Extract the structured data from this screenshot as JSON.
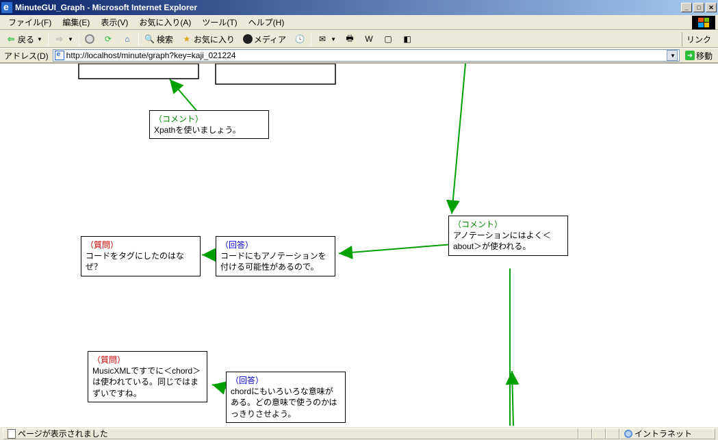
{
  "window": {
    "title": "MinuteGUI_Graph - Microsoft Internet Explorer"
  },
  "menu": {
    "file": "ファイル(F)",
    "edit": "編集(E)",
    "view": "表示(V)",
    "favorites": "お気に入り(A)",
    "tools": "ツール(T)",
    "help": "ヘルプ(H)"
  },
  "toolbar": {
    "back": "戻る",
    "search": "検索",
    "favorites": "お気に入り",
    "media": "メディア",
    "links": "リンク"
  },
  "address": {
    "label": "アドレス(D)",
    "url": "http://localhost/minute/graph?key=kaji_021224",
    "go": "移動"
  },
  "nodes": {
    "n1": {
      "tagType": "comment",
      "tag": "（コメント）",
      "text": "Xpathを使いましょう。"
    },
    "n2": {
      "tagType": "comment",
      "tag": "（コメント）",
      "text": "アノテーションにはよく＜about＞が使われる。"
    },
    "n3": {
      "tagType": "question",
      "tag": "（質問）",
      "text": "コードをタグにしたのはなぜ？"
    },
    "n4": {
      "tagType": "answer",
      "tag": "（回答）",
      "text": "コードにもアノテーションを付ける可能性があるので。"
    },
    "n5": {
      "tagType": "question",
      "tag": "（質問）",
      "text": "MusicXMLですでに＜chord＞は使われている。同じではまずいですね。"
    },
    "n6": {
      "tagType": "answer",
      "tag": "（回答）",
      "text": "chordにもいろいろな意味がある。どの意味で使うのかはっきりさせよう。"
    }
  },
  "status": {
    "left": "ページが表示されました",
    "zone": "イントラネット"
  }
}
